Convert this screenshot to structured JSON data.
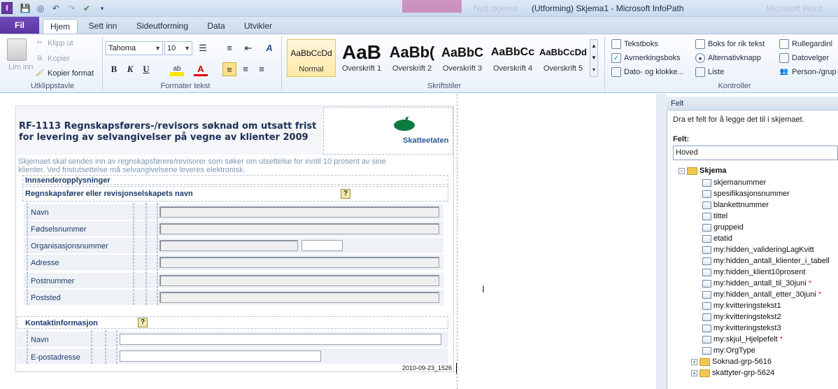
{
  "window": {
    "title": "(Utforming) Skjema1 - Microsoft InfoPath",
    "ghost_text": "Nytt skjema",
    "ghost_text2": "Microsoft Word",
    "app_icon_letter": "I"
  },
  "tabs": [
    {
      "label": "Fil"
    },
    {
      "label": "Hjem"
    },
    {
      "label": "Sett inn"
    },
    {
      "label": "Sideutforming"
    },
    {
      "label": "Data"
    },
    {
      "label": "Utvikler"
    }
  ],
  "ribbon": {
    "clipboard": {
      "paste": "Lim inn",
      "cut": "Klipp ut",
      "copy": "Kopier",
      "format_painter": "Kopier format",
      "group": "Utklippstavle"
    },
    "font": {
      "family": "Tahoma",
      "size": "10",
      "group": "Formater tekst"
    },
    "styles": {
      "group": "Skriftstiler",
      "items": [
        {
          "preview": "AaBbCcDd",
          "name": "Normal"
        },
        {
          "preview": "AaB",
          "name": "Overskrift 1"
        },
        {
          "preview": "AaBb(",
          "name": "Overskrift 2"
        },
        {
          "preview": "AaBbC",
          "name": "Overskrift 3"
        },
        {
          "preview": "AaBbCc",
          "name": "Overskrift 4"
        },
        {
          "preview": "AaBbCcDd",
          "name": "Overskrift 5"
        }
      ]
    },
    "controls": {
      "group": "Kontroller",
      "items": [
        "Tekstboks",
        "Boks for rik tekst",
        "Rullegardinl",
        "Avmerkingsboks",
        "Alternativknapp",
        "Datovelger",
        "Dato- og klokke...",
        "Liste",
        "Person-/grup"
      ]
    }
  },
  "form": {
    "title_line1": "RF-1113 Regnskapsførers-/revisors søknad om utsatt frist",
    "title_line2": "for levering av selvangivelser på vegne av klienter 2009",
    "logo_text": "Skatteetaten",
    "intro_line1": "Skjemaet skal sendes inn av regnskapsførere/revisorer som søker om utsettelse for inntil 10 prosent av sine",
    "intro_line2": "klienter. Ved fristutsettelse må selvangivelsene leveres elektronisk.",
    "section1": "Innsenderopplysninger",
    "subsection1": "Regnskapsfører eller revisjonselskapets navn",
    "fields1": [
      "Navn",
      "Fødselsnummer",
      "Organisasjonsnummer",
      "Adresse",
      "Postnummer",
      "Poststed"
    ],
    "section2": "Kontaktinformasjon",
    "fields2": [
      "Navn",
      "E-postadresse"
    ],
    "help": "?",
    "version": "2010-09-23_1526"
  },
  "pane": {
    "title": "Felt",
    "hint": "Dra et felt for å legge det til i skjemaet.",
    "felt_label": "Felt:",
    "felt_value": "Hoved",
    "root": "Skjema",
    "items": [
      {
        "name": "skjemanummer",
        "req": ""
      },
      {
        "name": "spesifikasjonsnummer",
        "req": ""
      },
      {
        "name": "blankettnummer",
        "req": ""
      },
      {
        "name": "tittel",
        "req": ""
      },
      {
        "name": "gruppeid",
        "req": ""
      },
      {
        "name": "etatid",
        "req": ""
      },
      {
        "name": "my:hidden_valideringLagKvitt",
        "req": ""
      },
      {
        "name": "my:hidden_antall_klienter_i_tabell",
        "req": ""
      },
      {
        "name": "my:hidden_klient10prosent",
        "req": ""
      },
      {
        "name": "my:hidden_antall_til_30juni",
        "req": "*"
      },
      {
        "name": "my:hidden_antall_etter_30juni",
        "req": "*"
      },
      {
        "name": "my:kvitteringstekst1",
        "req": ""
      },
      {
        "name": "my:kvitteringstekst2",
        "req": ""
      },
      {
        "name": "my:kvitteringstekst3",
        "req": ""
      },
      {
        "name": "my:skjul_Hjelpefelt",
        "req": "*"
      },
      {
        "name": "my:OrgType",
        "req": ""
      }
    ],
    "groups": [
      "Soknad-grp-5616",
      "skattyter-grp-5624"
    ]
  }
}
